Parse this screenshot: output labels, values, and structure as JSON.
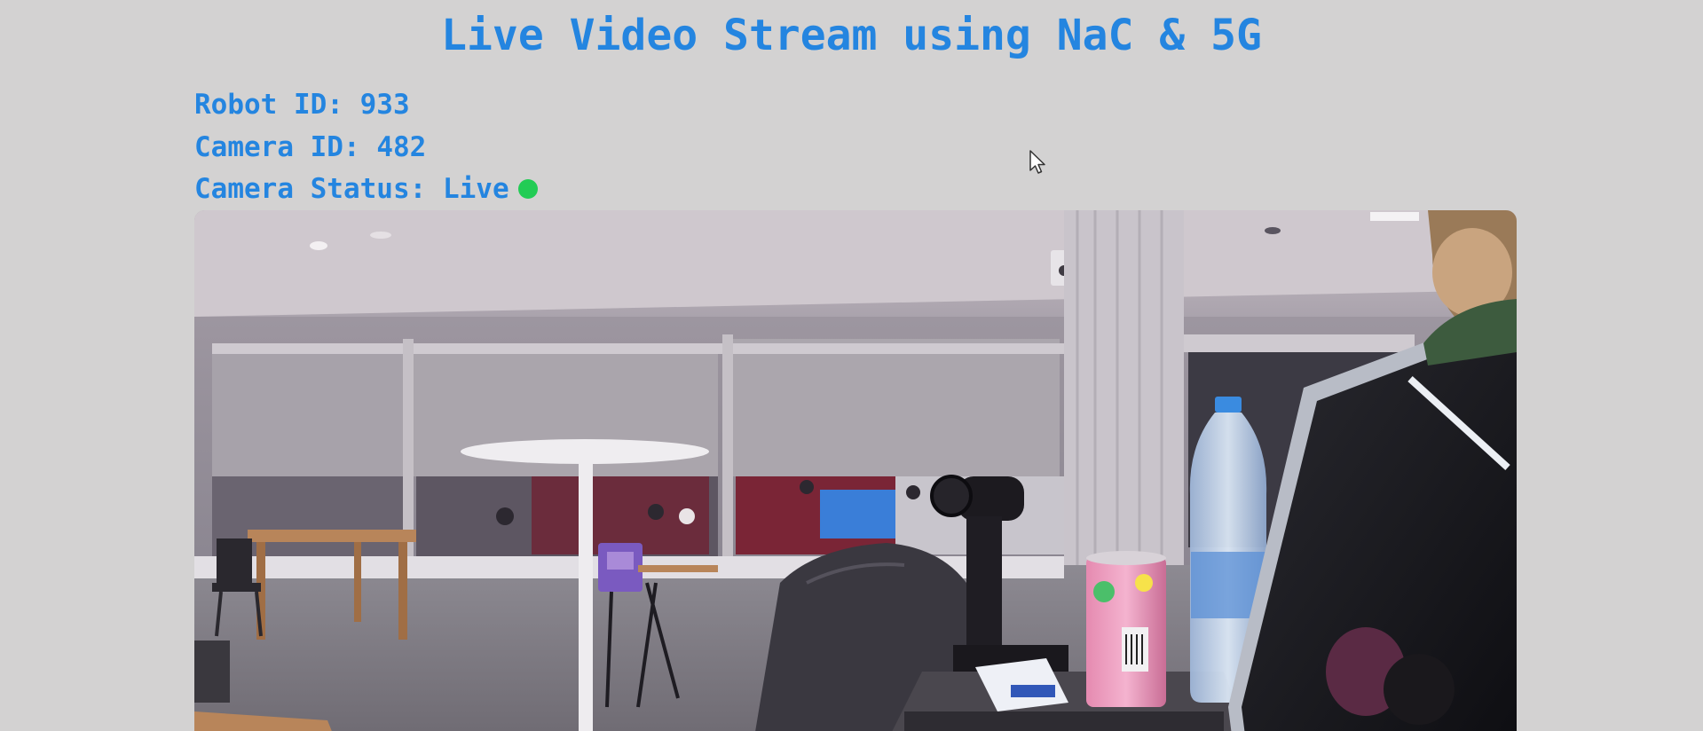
{
  "title": "Live Video Stream using NaC & 5G",
  "robot": {
    "label": "Robot ID: ",
    "value": "933"
  },
  "camera": {
    "label": "Camera ID: ",
    "value": "482"
  },
  "status": {
    "label": "Camera Status: ",
    "value": "Live",
    "indicator_color": "#22cc55"
  },
  "colors": {
    "accent": "#2485e0",
    "background": "#d3d2d2"
  },
  "icons": {
    "status_indicator": "green-dot-icon",
    "pointer": "mouse-cursor-icon"
  }
}
